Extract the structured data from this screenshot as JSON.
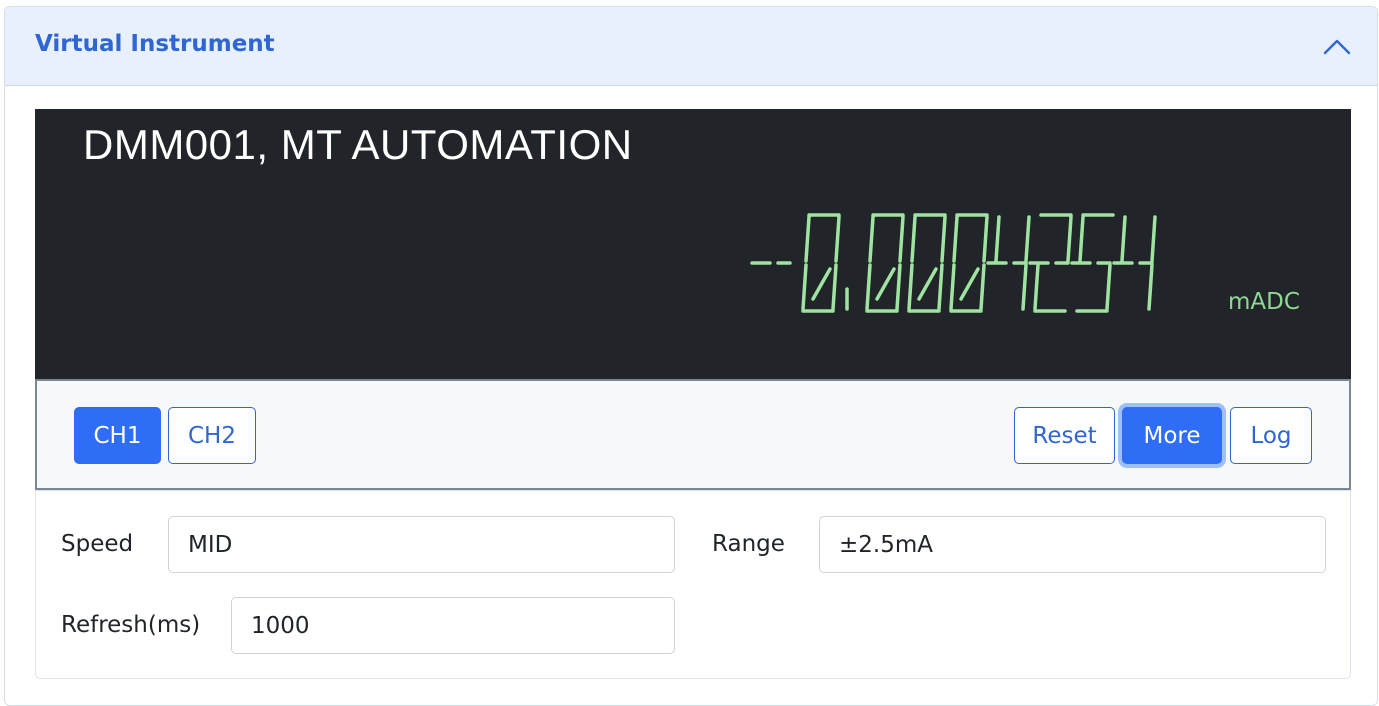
{
  "panel": {
    "title": "Virtual Instrument",
    "collapse_icon": "chevron-up-icon"
  },
  "display": {
    "device_title": "DMM001, MT AUTOMATION",
    "reading": "-0.0004254",
    "unit": "mADC",
    "background_color": "#212529",
    "segment_color": "#9fe3a1"
  },
  "channels": {
    "ch1_label": "CH1",
    "ch2_label": "CH2",
    "selected": "CH1"
  },
  "actions": {
    "reset_label": "Reset",
    "more_label": "More",
    "log_label": "Log"
  },
  "settings": {
    "speed_label": "Speed",
    "speed_value": "MID",
    "range_label": "Range",
    "range_value": "±2.5mA",
    "refresh_label": "Refresh(ms)",
    "refresh_value": "1000"
  },
  "colors": {
    "accent": "#2f6df6",
    "header_bg": "#e8f0fd",
    "title_color": "#2f66d1"
  }
}
